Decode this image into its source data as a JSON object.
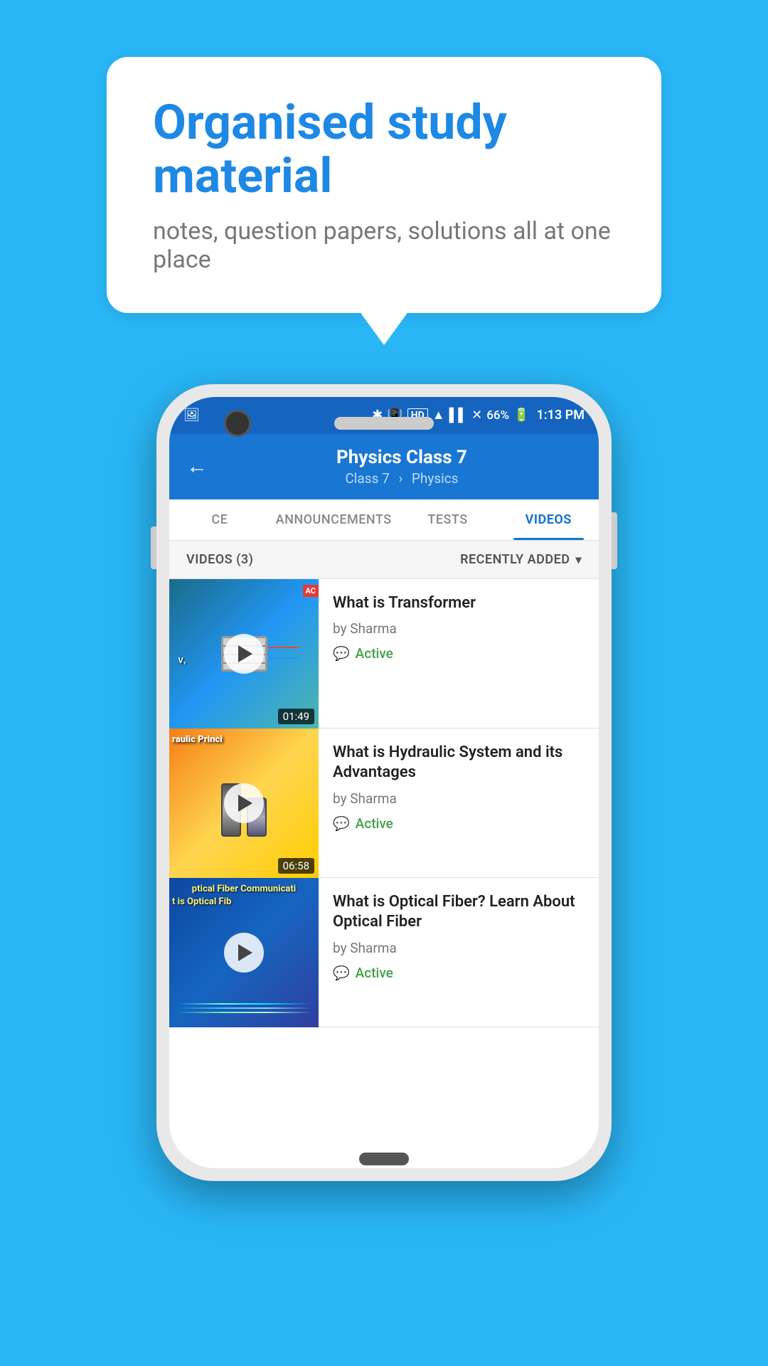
{
  "background_color": "#29b6f6",
  "speech_bubble": {
    "title": "Organised study material",
    "subtitle": "notes, question papers, solutions all at one place"
  },
  "phone": {
    "status_bar": {
      "battery": "66%",
      "time": "1:13 PM",
      "signal": "HD"
    },
    "header": {
      "title": "Physics Class 7",
      "breadcrumb_class": "Class 7",
      "breadcrumb_subject": "Physics",
      "back_label": "←"
    },
    "tabs": [
      {
        "label": "CE",
        "active": false
      },
      {
        "label": "ANNOUNCEMENTS",
        "active": false
      },
      {
        "label": "TESTS",
        "active": false
      },
      {
        "label": "VIDEOS",
        "active": true
      }
    ],
    "videos_header": {
      "count_label": "VIDEOS (3)",
      "sort_label": "RECENTLY ADDED"
    },
    "videos": [
      {
        "title": "What is  Transformer",
        "author": "by Sharma",
        "status": "Active",
        "duration": "01:49",
        "thumb_type": "transformer"
      },
      {
        "title": "What is Hydraulic System and its Advantages",
        "author": "by Sharma",
        "status": "Active",
        "duration": "06:58",
        "thumb_type": "hydraulic"
      },
      {
        "title": "What is Optical Fiber? Learn About Optical Fiber",
        "author": "by Sharma",
        "status": "Active",
        "duration": "",
        "thumb_type": "optical"
      }
    ]
  }
}
